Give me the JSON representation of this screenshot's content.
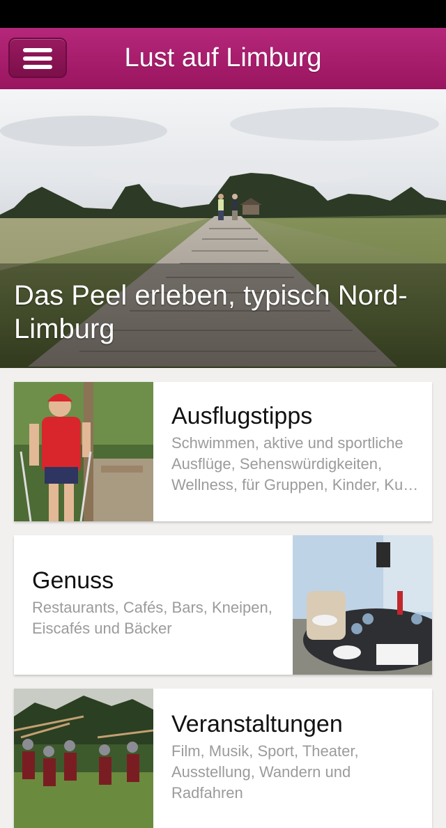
{
  "app": {
    "title": "Lust auf Limburg"
  },
  "hero": {
    "title": "Das Peel erleben, typisch Nord-Limburg"
  },
  "cards": [
    {
      "title": "Ausflugstipps",
      "description": "Schwimmen, aktive und sportliche Ausflüge, Sehenswürdigkeiten, Wellness, für Gruppen, Kinder, Ku…"
    },
    {
      "title": "Genuss",
      "description": "Restaurants, Cafés, Bars, Kneipen, Eiscafés und Bäcker"
    },
    {
      "title": "Veranstaltungen",
      "description": "Film, Musik, Sport, Theater, Ausstellung, Wandern und Radfahren"
    }
  ],
  "colors": {
    "brand": "#a91d6e",
    "status_bar": "#000000",
    "card_background": "#ffffff",
    "description_text": "#9b9b9b"
  },
  "icons": {
    "menu": "hamburger-menu-icon"
  }
}
